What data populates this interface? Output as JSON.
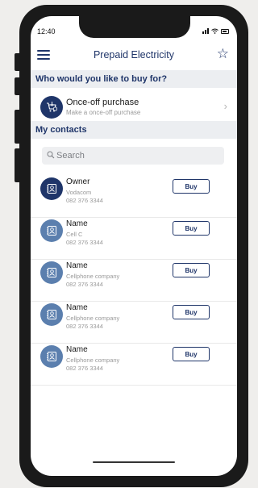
{
  "status_bar": {
    "time": "12:40"
  },
  "header": {
    "title": "Prepaid Electricity"
  },
  "buy_for": {
    "heading": "Who would you like to buy for?",
    "once_off": {
      "title": "Once-off purchase",
      "subtitle": "Make a once-off purchase"
    }
  },
  "contacts": {
    "heading": "My contacts",
    "search_placeholder": "Search",
    "buy_label": "Buy",
    "items": [
      {
        "name": "Owner",
        "carrier": "Vodacom",
        "phone": "082 376 3344"
      },
      {
        "name": "Name",
        "carrier": "Cell C",
        "phone": "082 376 3344"
      },
      {
        "name": "Name",
        "carrier": "Cellphone company",
        "phone": "082 376 3344"
      },
      {
        "name": "Name",
        "carrier": "Cellphone company",
        "phone": "082 376 3344"
      },
      {
        "name": "Name",
        "carrier": "Cellphone company",
        "phone": "082 376 3344"
      }
    ]
  },
  "colors": {
    "brand": "#1f3569",
    "avatar_light": "#5b7fae",
    "section_bg": "#eceef1"
  }
}
